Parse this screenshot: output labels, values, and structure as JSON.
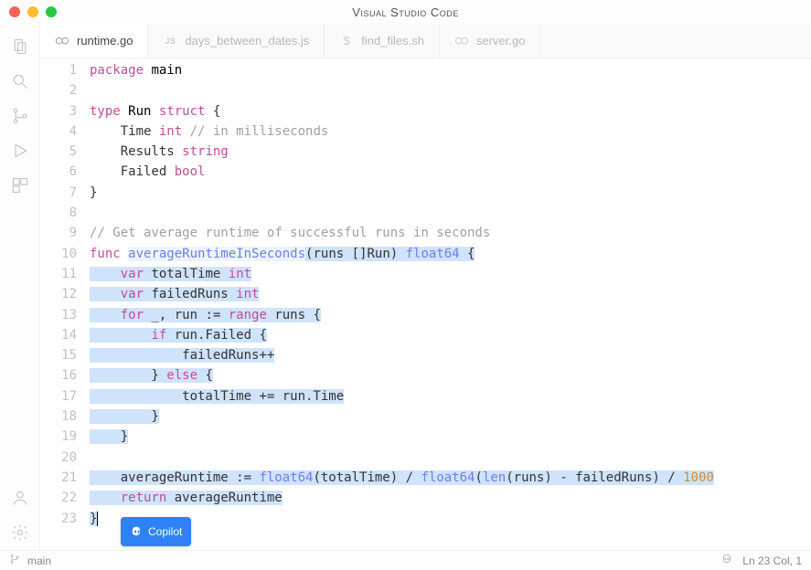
{
  "window": {
    "title": "Visual Studio Code"
  },
  "tabs": [
    {
      "icon": "go",
      "label": "runtime.go",
      "active": true
    },
    {
      "icon": "js",
      "label": "days_between_dates.js",
      "active": false
    },
    {
      "icon": "sh",
      "label": "find_files.sh",
      "active": false
    },
    {
      "icon": "go",
      "label": "server.go",
      "active": false
    }
  ],
  "code": {
    "lines": [
      {
        "n": 1,
        "sel": false,
        "html": "<span class='kw'>package</span> <span class='goown'>main</span>"
      },
      {
        "n": 2,
        "sel": false,
        "html": ""
      },
      {
        "n": 3,
        "sel": false,
        "html": "<span class='kw'>type</span> <span class='goown'>Run</span> <span class='kw'>struct</span> {"
      },
      {
        "n": 4,
        "sel": false,
        "html": "    Time <span class='kw'>int</span> <span class='com'>// in milliseconds</span>"
      },
      {
        "n": 5,
        "sel": false,
        "html": "    Results <span class='kw'>string</span>"
      },
      {
        "n": 6,
        "sel": false,
        "html": "    Failed <span class='kw'>bool</span>"
      },
      {
        "n": 7,
        "sel": false,
        "html": "}"
      },
      {
        "n": 8,
        "sel": false,
        "html": ""
      },
      {
        "n": 9,
        "sel": false,
        "html": "<span class='com'>// Get average runtime of successful runs in seconds</span>"
      },
      {
        "n": 10,
        "sel": false,
        "html": "<span class='kw'>func</span> <span class='fn fname-hl'>averageRuntimeInSeconds</span><span class='sel'>(runs []Run) </span><span class='sel'><span class='ident-type'>float64</span></span><span class='sel'> {</span>"
      },
      {
        "n": 11,
        "sel": true,
        "html": "    <span class='kw'>var</span> totalTime <span class='kw'>int</span>"
      },
      {
        "n": 12,
        "sel": true,
        "html": "    <span class='kw'>var</span> failedRuns <span class='kw'>int</span>"
      },
      {
        "n": 13,
        "sel": true,
        "html": "    <span class='kw'>for</span> _, run := <span class='kw'>range</span> runs {"
      },
      {
        "n": 14,
        "sel": true,
        "html": "        <span class='kw'>if</span> run.Failed {"
      },
      {
        "n": 15,
        "sel": true,
        "html": "            failedRuns++"
      },
      {
        "n": 16,
        "sel": true,
        "html": "        } <span class='kw'>else</span> {"
      },
      {
        "n": 17,
        "sel": true,
        "html": "            totalTime += run.Time"
      },
      {
        "n": 18,
        "sel": true,
        "html": "        }"
      },
      {
        "n": 19,
        "sel": true,
        "html": "    }"
      },
      {
        "n": 20,
        "sel": true,
        "html": ""
      },
      {
        "n": 21,
        "sel": true,
        "html": "    averageRuntime := <span class='builtin'>float64</span>(totalTime) / <span class='builtin'>float64</span>(<span class='builtin'>len</span>(runs) - failedRuns) / <span class='num'>1000</span>"
      },
      {
        "n": 22,
        "sel": true,
        "html": "    <span class='kw'>return</span> averageRuntime"
      },
      {
        "n": 23,
        "sel": true,
        "html": "}<span class='cursor-caret'></span>"
      }
    ]
  },
  "copilot": {
    "label": "Copilot"
  },
  "status": {
    "branch": "main",
    "linecol": "Ln 23 Col, 1"
  }
}
